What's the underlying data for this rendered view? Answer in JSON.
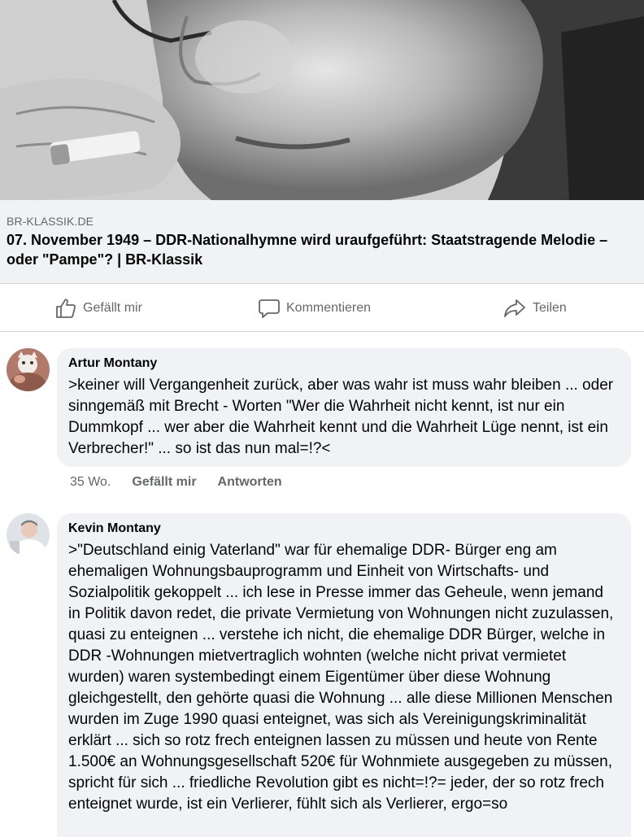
{
  "link_preview": {
    "domain": "BR-KLASSIK.DE",
    "title": "07. November 1949 – DDR-Nationalhymne wird uraufgeführt: Staatstragende Melodie – oder \"Pampe\"? | BR-Klassik"
  },
  "actions": {
    "like_label": "Gefällt mir",
    "comment_label": "Kommentieren",
    "share_label": "Teilen"
  },
  "comments": [
    {
      "author": "Artur Montany",
      "text": ">keiner will Vergangenheit zurück, aber was wahr ist muss wahr bleiben ... oder sinngemäß mit Brecht - Worten \"Wer die Wahrheit nicht kennt, ist nur ein Dummkopf ... wer aber die Wahrheit kennt und die Wahrheit Lüge nennt, ist ein Verbrecher!\"  ... so ist das nun mal=!?<",
      "time": "35 Wo.",
      "like_label": "Gefällt mir",
      "reply_label": "Antworten"
    },
    {
      "author": "Kevin Montany",
      "text": ">\"Deutschland einig Vaterland\" war für ehemalige DDR- Bürger eng am ehemaligen Wohnungsbauprogramm und Einheit von Wirtschafts- und Sozialpolitik gekoppelt ... ich lese in Presse immer das Geheule, wenn jemand in Politik davon redet, die private Vermietung von Wohnungen nicht zuzulassen, quasi zu enteignen ... verstehe ich nicht, die ehemalige DDR Bürger, welche in DDR -Wohnungen mietvertraglich wohnten (welche nicht privat vermietet wurden)  waren systembedingt einem Eigentümer über diese Wohnung gleichgestellt, den gehörte quasi die Wohnung  ... alle diese  Millionen Menschen wurden im Zuge 1990 quasi enteignet, was sich als Vereinigungskriminalität erklärt ... sich so rotz frech enteignen lassen zu müssen und heute von Rente 1.500€ an Wohnungsgesellschaft 520€  für Wohnmiete ausgegeben zu müssen, spricht für sich ... friedliche Revolution gibt es nicht=!?= jeder, der so rotz frech enteignet wurde,  ist ein Verlierer, fühlt sich als Verlierer, ergo=so"
    }
  ]
}
